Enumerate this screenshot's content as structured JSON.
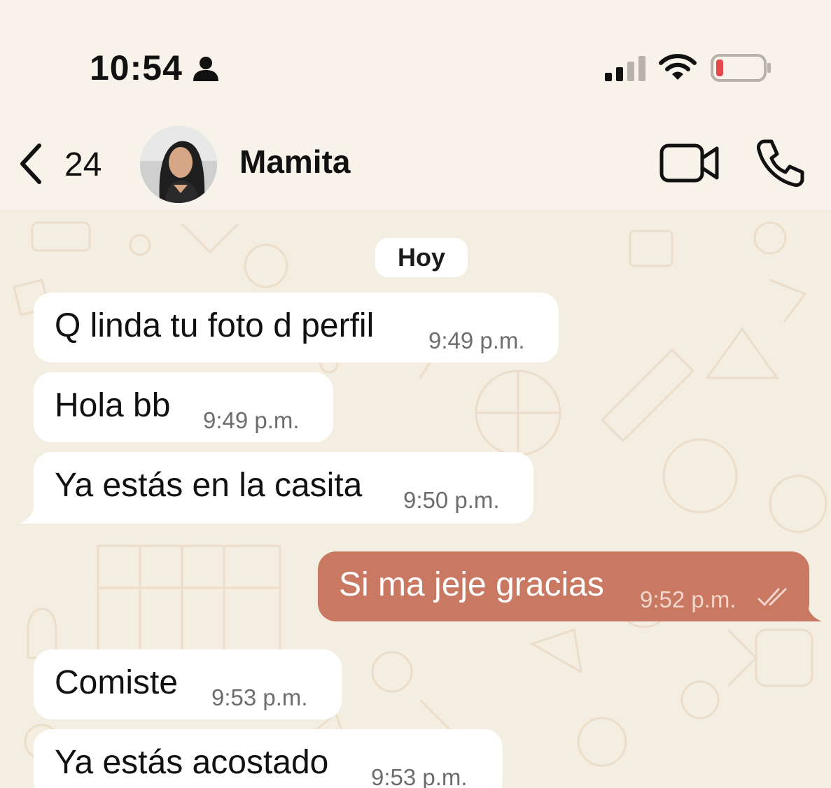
{
  "status_bar": {
    "time": "10:54",
    "icons": [
      "person-icon",
      "signal-icon",
      "wifi-icon",
      "battery-icon"
    ]
  },
  "header": {
    "back_count": "24",
    "contact_name": "Mamita",
    "icons": [
      "chevron-left-icon",
      "video-call-icon",
      "phone-call-icon"
    ]
  },
  "chat": {
    "date_label": "Hoy",
    "messages": [
      {
        "direction": "incoming",
        "text": "Q linda tu foto d perfil",
        "time": "9:49 p.m."
      },
      {
        "direction": "incoming",
        "text": "Hola bb",
        "time": "9:49 p.m."
      },
      {
        "direction": "incoming",
        "text": "Ya estás en la casita",
        "time": "9:50 p.m."
      },
      {
        "direction": "outgoing",
        "text": "Si ma jeje gracias",
        "time": "9:52 p.m.",
        "status": "read"
      },
      {
        "direction": "incoming",
        "text": "Comiste",
        "time": "9:53 p.m."
      },
      {
        "direction": "incoming",
        "text": "Ya estás acostado",
        "time": "9:53 p.m."
      }
    ]
  },
  "colors": {
    "background": "#f6f1e7",
    "incoming_bubble": "#ffffff",
    "outgoing_bubble": "#c97862",
    "battery_low": "#e5484d"
  }
}
